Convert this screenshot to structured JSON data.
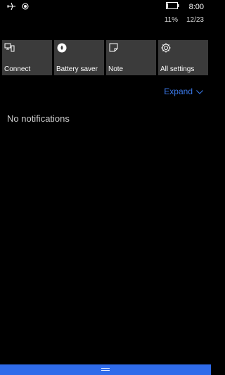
{
  "status_bar": {
    "icons": {
      "airplane": "airplane-icon",
      "location": "location-icon",
      "battery": "battery-icon"
    },
    "time": "8:00",
    "battery_percent": "11%",
    "battery_level": 0.11,
    "date": "12/23"
  },
  "quick_actions": [
    {
      "label": "Connect",
      "icon": "connect-icon"
    },
    {
      "label": "Battery saver",
      "icon": "battery-saver-icon"
    },
    {
      "label": "Note",
      "icon": "note-icon"
    },
    {
      "label": "All settings",
      "icon": "gear-icon"
    }
  ],
  "expand": {
    "label": "Expand",
    "icon": "chevron-down-icon"
  },
  "notifications": {
    "empty_text": "No notifications"
  },
  "colors": {
    "background": "#000000",
    "tile": "#3b3b3b",
    "accent": "#3a78e8",
    "handle": "#2f6bea"
  }
}
